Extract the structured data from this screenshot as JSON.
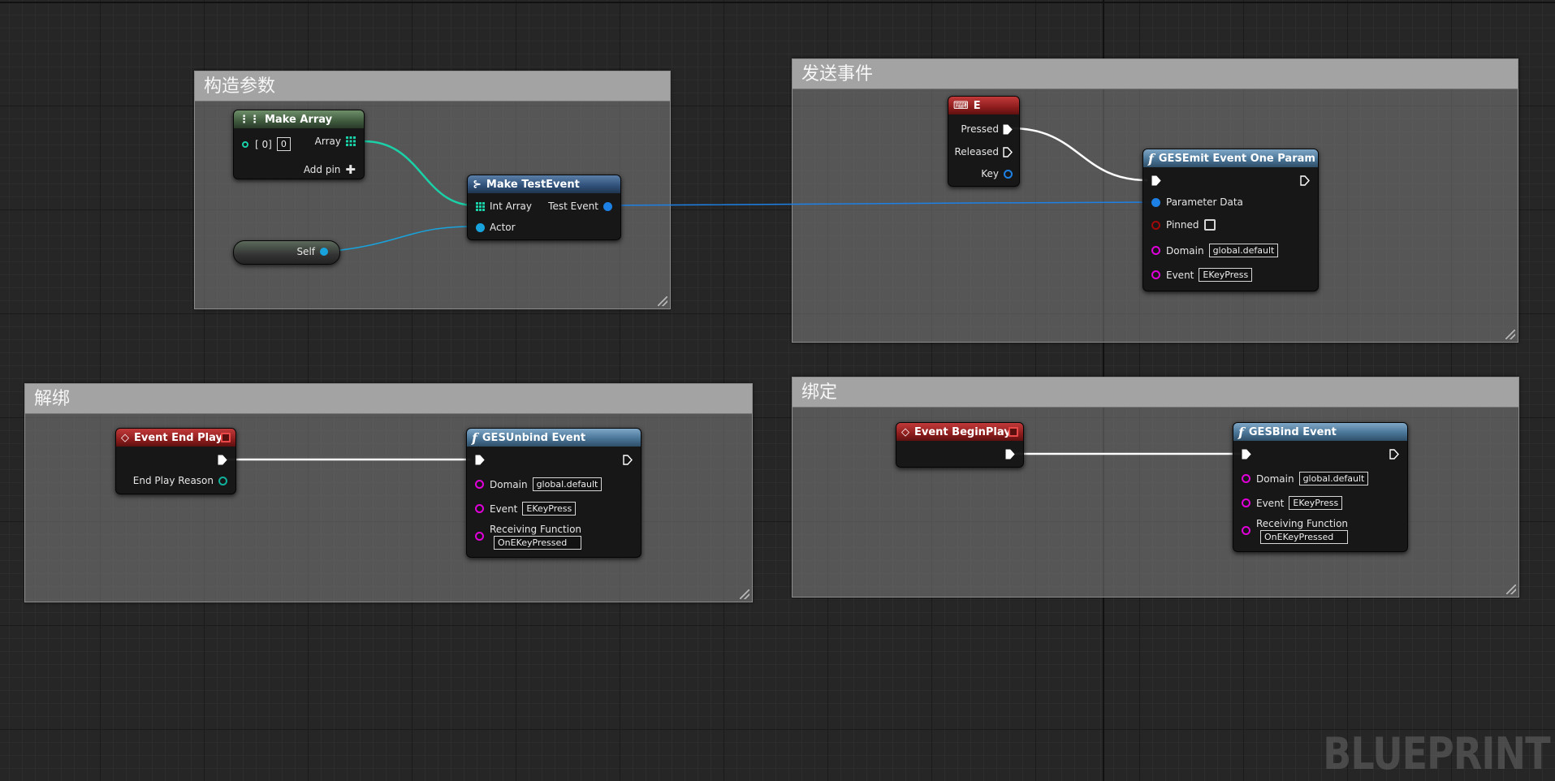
{
  "comments": {
    "construct_params": "构造参数",
    "send_event": "发送事件",
    "unbind": "解绑",
    "bind": "绑定"
  },
  "make_array": {
    "title": "Make Array",
    "index_label": "[ 0]",
    "index_value": "0",
    "array_label": "Array",
    "add_pin_label": "Add pin",
    "add_pin_icon": "plus-icon"
  },
  "self_node": {
    "label": "Self"
  },
  "make_test_event": {
    "title": "Make TestEvent",
    "int_array_label": "Int Array",
    "actor_label": "Actor",
    "test_event_label": "Test Event"
  },
  "key_e": {
    "title": "E",
    "pressed_label": "Pressed",
    "released_label": "Released",
    "key_label": "Key"
  },
  "emit": {
    "title": "GESEmit Event One Param",
    "parameter_data_label": "Parameter Data",
    "pinned_label": "Pinned",
    "domain_label": "Domain",
    "domain_value": "global.default",
    "event_label": "Event",
    "event_value": "EKeyPress"
  },
  "event_end_play": {
    "title": "Event End Play",
    "reason_label": "End Play Reason"
  },
  "unbind_node": {
    "title": "GESUnbind Event",
    "domain_label": "Domain",
    "domain_value": "global.default",
    "event_label": "Event",
    "event_value": "EKeyPress",
    "receiving_label": "Receiving Function",
    "receiving_value": "OnEKeyPressed"
  },
  "event_begin_play": {
    "title": "Event BeginPlay"
  },
  "bind_node": {
    "title": "GESBind Event",
    "domain_label": "Domain",
    "domain_value": "global.default",
    "event_label": "Event",
    "event_value": "EKeyPress",
    "receiving_label": "Receiving Function",
    "receiving_value": "OnEKeyPressed"
  },
  "colors": {
    "exec_wire": "#ffffff",
    "struct_wire": "#1d80e4",
    "array_wire": "#1ad1a8",
    "object_wire": "#18a3dd",
    "string_pin": "#e000d9",
    "event_header": "#8e1d1d",
    "function_header": "#4a7597"
  },
  "watermark": "BLUEPRINT"
}
